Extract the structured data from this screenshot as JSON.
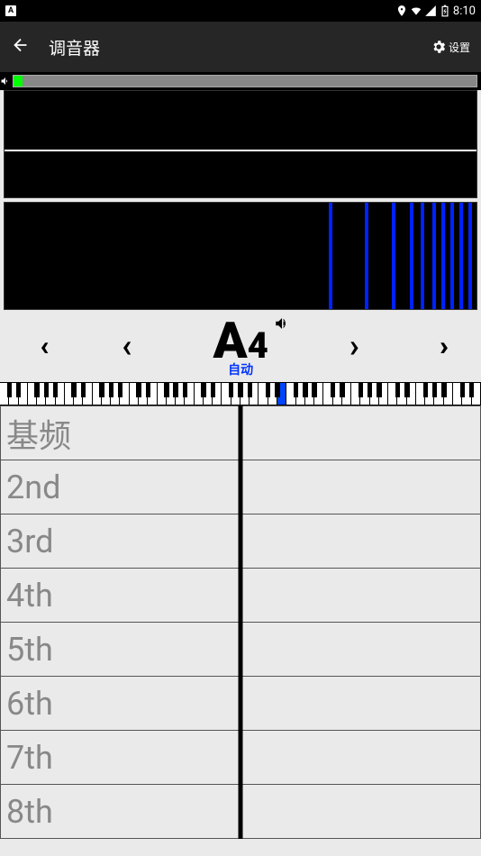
{
  "status": {
    "time": "8:10"
  },
  "header": {
    "title": "调音器",
    "settings_label": "设置"
  },
  "note": {
    "letter": "A",
    "octave": "4",
    "mode": "自动"
  },
  "spectrum_bars": [
    360,
    400,
    430,
    450,
    462,
    475,
    485,
    495,
    505,
    515
  ],
  "harmonics": {
    "rows": [
      "基频",
      "2nd",
      "3rd",
      "4th",
      "5th",
      "6th",
      "7th",
      "8th"
    ]
  },
  "piano": {
    "white_count": 52,
    "highlight_index": 30,
    "black_offsets": [
      0,
      1,
      3,
      4,
      5,
      7,
      8,
      10,
      11,
      12,
      14,
      15,
      17,
      18,
      19,
      21,
      22,
      24,
      25,
      26,
      28,
      29,
      31,
      32,
      33,
      35,
      36,
      38,
      39,
      40,
      42,
      43,
      45,
      46,
      47,
      49,
      50
    ]
  }
}
